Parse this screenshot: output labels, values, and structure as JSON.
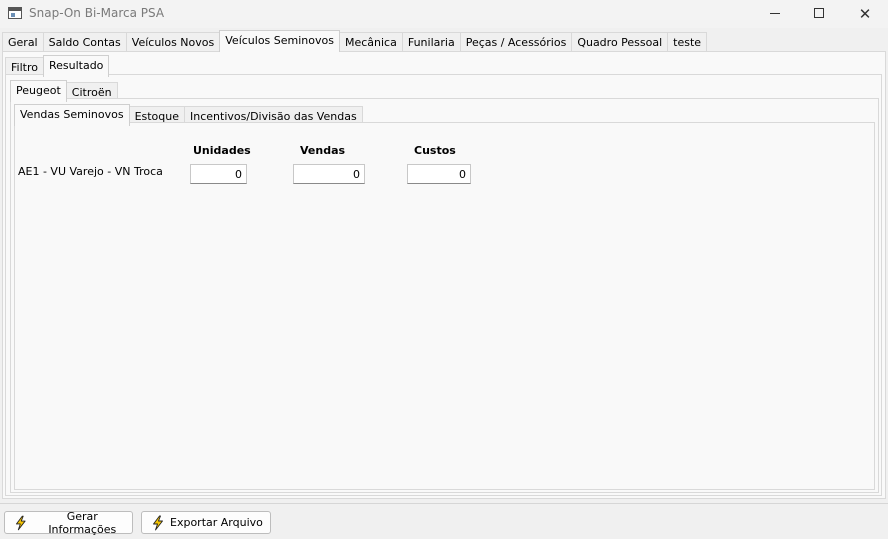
{
  "window": {
    "title": "Snap-On Bi-Marca PSA",
    "minimize": "—",
    "maximize": "",
    "close": "✕"
  },
  "main_tabs": [
    "Geral",
    "Saldo Contas",
    "Veículos Novos",
    "Veículos Seminovos",
    "Mecânica",
    "Funilaria",
    "Peças / Acessórios",
    "Quadro Pessoal",
    "teste"
  ],
  "mode_tabs": [
    "Filtro",
    "Resultado"
  ],
  "brand_tabs": [
    "Peugeot",
    "Citroën"
  ],
  "sub_tabs": [
    "Vendas Seminovos",
    "Estoque",
    "Incentivos/Divisão das Vendas"
  ],
  "table": {
    "headers": {
      "units": "Unidades",
      "sales": "Vendas",
      "costs": "Custos"
    },
    "row": {
      "label": "AE1 - VU Varejo - VN Troca",
      "units": "0",
      "sales": "0",
      "costs": "0"
    }
  },
  "buttons": {
    "gerar": "Gerar Informações",
    "exportar": "Exportar Arquivo"
  },
  "icons": {
    "bolt": "lightning-bolt-icon",
    "bolt_color": "#f5c400"
  }
}
